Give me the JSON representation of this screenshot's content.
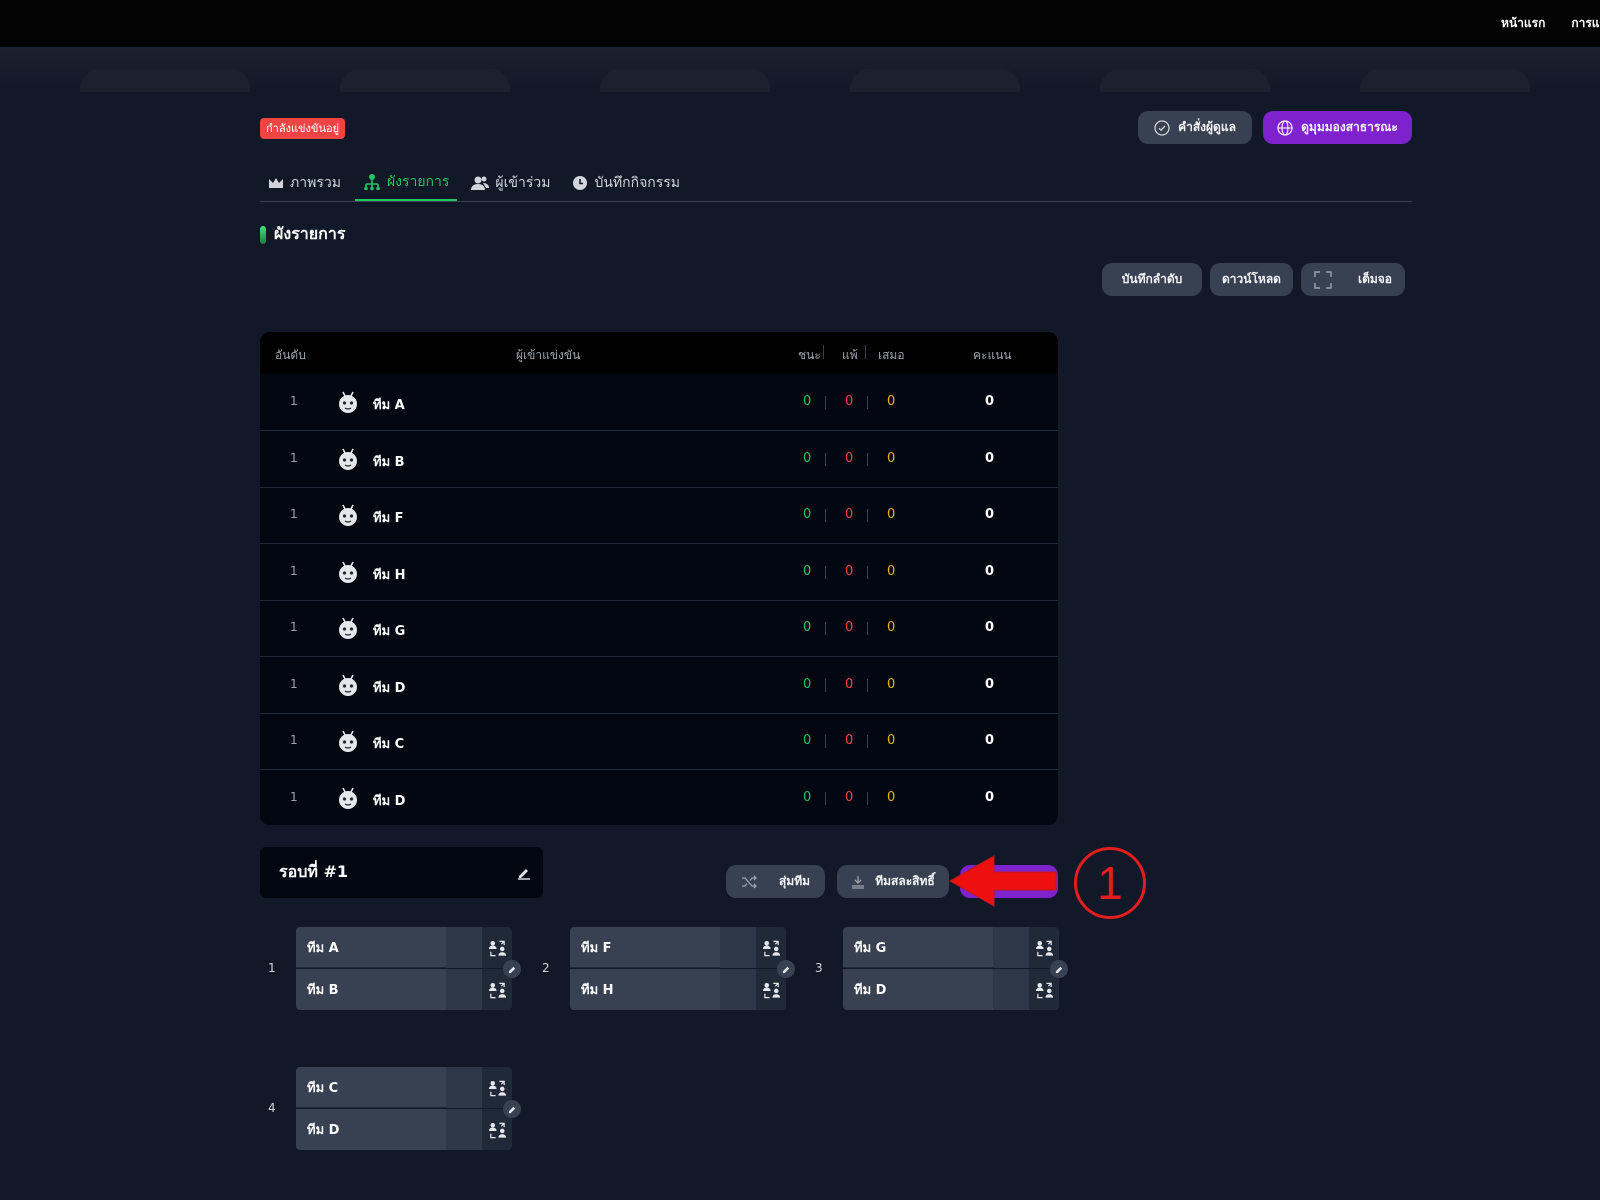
{
  "nav": {
    "home": "หน้าแรก",
    "competitions": "การแข่งขัน"
  },
  "status": {
    "label": "กำลังแข่งขันอยู่",
    "color": "#ef4444"
  },
  "header_buttons": {
    "admin": "คำสั่งผู้ดูแล",
    "public_view": "ดูมุมมองสาธารณะ"
  },
  "tabs": [
    {
      "label": "ภาพรวม",
      "icon": "crown-icon"
    },
    {
      "label": "ผังรายการ",
      "icon": "bracket-icon",
      "active": true
    },
    {
      "label": "ผู้เข้าร่วม",
      "icon": "users-icon"
    },
    {
      "label": "บันทึกกิจกรรม",
      "icon": "clock-icon"
    }
  ],
  "section": {
    "title": "ผังรายการ"
  },
  "toolbar": {
    "save_order": "บันทึกลำดับ",
    "download": "ดาวน์โหลด",
    "fullscreen": "เต็มจอ"
  },
  "standings": {
    "headers": {
      "rank": "อันดับ",
      "participant": "ผู้เข้าแข่งขัน",
      "win": "ชนะ",
      "loss": "แพ้",
      "draw": "เสมอ",
      "points": "คะแนน"
    },
    "rows": [
      {
        "rank": "1",
        "team": "ทีม A",
        "win": "0",
        "loss": "0",
        "draw": "0",
        "points": "0"
      },
      {
        "rank": "1",
        "team": "ทีม B",
        "win": "0",
        "loss": "0",
        "draw": "0",
        "points": "0"
      },
      {
        "rank": "1",
        "team": "ทีม F",
        "win": "0",
        "loss": "0",
        "draw": "0",
        "points": "0"
      },
      {
        "rank": "1",
        "team": "ทีม H",
        "win": "0",
        "loss": "0",
        "draw": "0",
        "points": "0"
      },
      {
        "rank": "1",
        "team": "ทีม G",
        "win": "0",
        "loss": "0",
        "draw": "0",
        "points": "0"
      },
      {
        "rank": "1",
        "team": "ทีม D",
        "win": "0",
        "loss": "0",
        "draw": "0",
        "points": "0"
      },
      {
        "rank": "1",
        "team": "ทีม C",
        "win": "0",
        "loss": "0",
        "draw": "0",
        "points": "0"
      },
      {
        "rank": "1",
        "team": "ทีม D",
        "win": "0",
        "loss": "0",
        "draw": "0",
        "points": "0"
      }
    ]
  },
  "round": {
    "title": "รอบที่ #1"
  },
  "round_buttons": {
    "shuffle": "สุ่มทีม",
    "bye": "ทีมสละสิทธิ์"
  },
  "annotation": {
    "number": "1",
    "color": "#e11d1d"
  },
  "matches": [
    {
      "number": "1",
      "team1": "ทีม A",
      "team2": "ทีม B"
    },
    {
      "number": "2",
      "team1": "ทีม F",
      "team2": "ทีม H"
    },
    {
      "number": "3",
      "team1": "ทีม G",
      "team2": "ทีม D"
    },
    {
      "number": "4",
      "team1": "ทีม C",
      "team2": "ทีม D"
    }
  ]
}
